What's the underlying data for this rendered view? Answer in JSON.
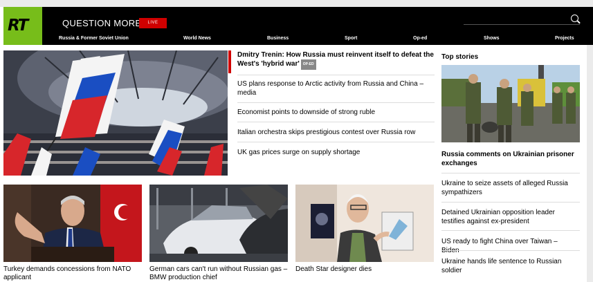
{
  "header": {
    "logo": "RT",
    "tagline": "QUESTION MORE",
    "live_label": "LIVE",
    "nav": [
      "Russia & Former Soviet Union",
      "World News",
      "Business",
      "Sport",
      "Op-ed",
      "Shows",
      "Projects"
    ]
  },
  "main": {
    "lead_headline": "Dmitry Trenin: How Russia must reinvent itself to defeat the West's 'hybrid war'",
    "lead_badge": "OP-ED",
    "headlines": [
      "US plans response to Arctic activity from Russia and China – media",
      "Economist points to downside of strong ruble",
      "Italian orchestra skips prestigious contest over Russia row",
      "UK gas prices surge on supply shortage"
    ]
  },
  "cards": [
    "Turkey demands concessions from NATO applicant",
    "German cars can't run without Russian gas – BMW production chief",
    "Death Star designer dies"
  ],
  "top_stories": {
    "title": "Top stories",
    "lead": "Russia comments on Ukrainian prisoner exchanges",
    "items": [
      "Ukraine to seize assets of alleged Russia sympathizers",
      "Detained Ukrainian opposition leader testifies against ex-president",
      "US ready to fight China over Taiwan – Biden",
      "Ukraine hands life sentence to Russian soldier"
    ]
  },
  "colors": {
    "brand_green": "#77bd1a",
    "live_red": "#d00000",
    "header_black": "#000000"
  },
  "icons": {
    "search": "search-icon"
  }
}
